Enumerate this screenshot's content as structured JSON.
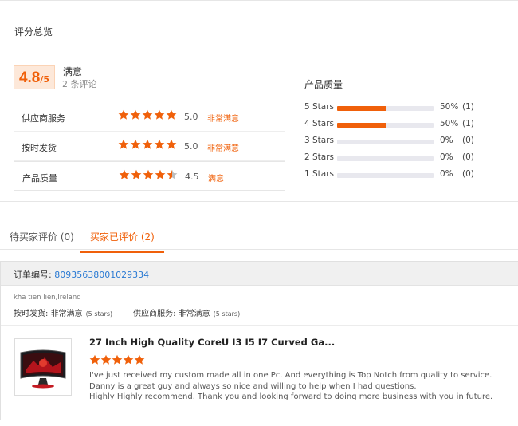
{
  "overview": {
    "title": "评分总览",
    "score": "4.8",
    "score_suffix": "/5",
    "satisfaction": "满意",
    "review_count": "2 条评论",
    "rows": [
      {
        "name": "供应商服务",
        "score": "5.0",
        "text": "非常满意",
        "stars": 5
      },
      {
        "name": "按时发货",
        "score": "5.0",
        "text": "非常满意",
        "stars": 5
      },
      {
        "name": "产品质量",
        "score": "4.5",
        "text": "满意",
        "stars": 4.5
      }
    ],
    "accent_color": "#f0600a"
  },
  "distribution": {
    "title": "产品质量",
    "rows": [
      {
        "label": "5 Stars",
        "fraction": 0.5,
        "pct": "50%",
        "count": "(1)"
      },
      {
        "label": "4 Stars",
        "fraction": 0.5,
        "pct": "50%",
        "count": "(1)"
      },
      {
        "label": "3 Stars",
        "fraction": 0,
        "pct": "0%",
        "count": "(0)"
      },
      {
        "label": "2 Stars",
        "fraction": 0,
        "pct": "0%",
        "count": "(0)"
      },
      {
        "label": "1 Stars",
        "fraction": 0,
        "pct": "0%",
        "count": "(0)"
      }
    ]
  },
  "tabs": [
    {
      "label": "待买家评价 (0)"
    },
    {
      "label": "买家已评价 (2)"
    }
  ],
  "review": {
    "order_label": "订单编号: ",
    "order_number": "80935638001029334",
    "buyer": "kha tien lien,Ireland",
    "ontime_label": "按时发货: ",
    "ontime_value": "非常满意",
    "ontime_stars": "(5 stars)",
    "service_label": "供应商服务: ",
    "service_value": "非常满意",
    "service_stars": "(5 stars)",
    "product_title": "27 Inch High Quality CoreU I3 I5 I7 Curved Ga...",
    "product_rating": 5,
    "comment_lines": [
      "I've just received my custom made all in one Pc. And everything is Top Notch from quality to service.",
      "Danny is a great guy and always so nice and willing to help when I had questions.",
      "Highly Highly recommend. Thank you and looking forward to doing more business with you in future."
    ]
  }
}
